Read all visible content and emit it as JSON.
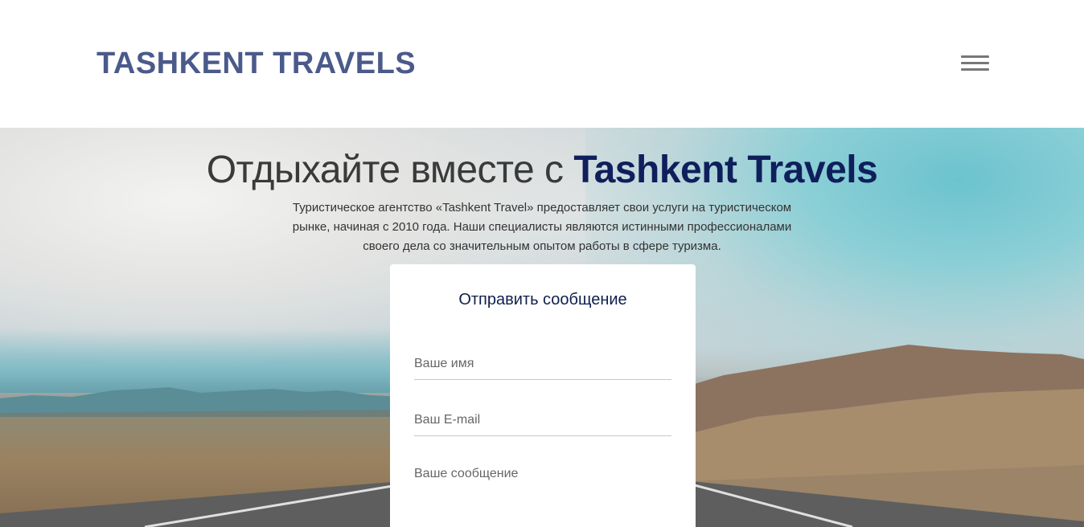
{
  "header": {
    "logo": "TASHKENT TRAVELS",
    "menu_icon": "hamburger-menu-icon"
  },
  "hero": {
    "title_light": "Отдыхайте вместе с ",
    "title_brand": "Tashkent Travels",
    "description": "Туристическое агентство «Tashkent Travel» предоставляет свои услуги на туристическом рынке, начиная с 2010 года. Наши специалисты являются истинными профессионалами своего дела со значительным опытом работы в сфере туризма."
  },
  "form": {
    "title": "Отправить сообщение",
    "name_placeholder": "Ваше имя",
    "email_placeholder": "Ваш E-mail",
    "message_placeholder": "Ваше сообщение"
  },
  "colors": {
    "logo": "#4a5a8a",
    "brand_dark": "#0f1f5c",
    "menu_icon": "#777777"
  }
}
